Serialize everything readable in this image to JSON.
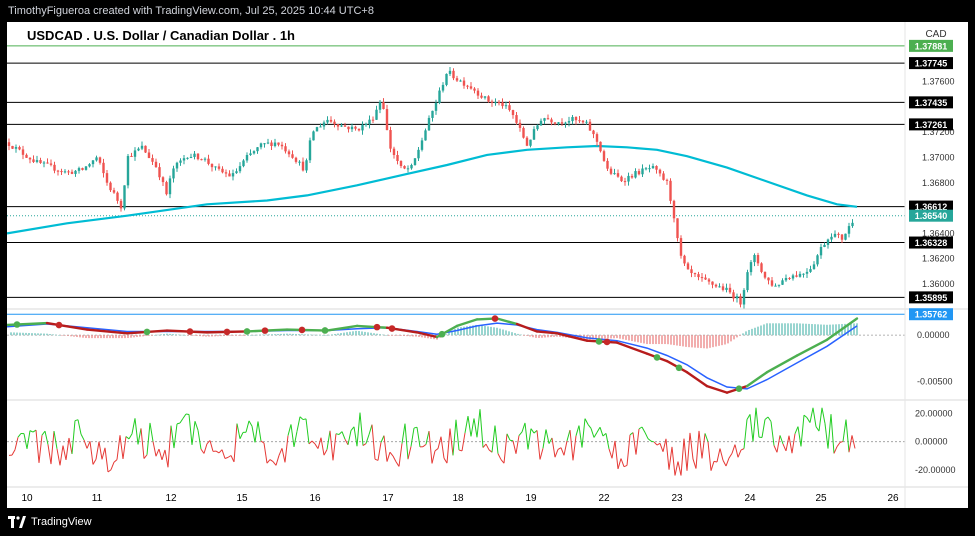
{
  "watermark": "TimothyFigueroa created with TradingView.com, Jul 25, 2025 10:44 UTC+8",
  "brand": "TradingView",
  "currency": "CAD",
  "chart_data": [
    {
      "type": "candlestick",
      "title": "USDCAD . U.S. Dollar / Canadian Dollar . 1h",
      "x_ticks": [
        "10",
        "11",
        "12",
        "15",
        "16",
        "17",
        "18",
        "19",
        "22",
        "23",
        "24",
        "25",
        "26"
      ],
      "y_ticks": [
        "1.37600",
        "1.37200",
        "1.37000",
        "1.36800",
        "1.36400",
        "1.36200",
        "1.36000"
      ],
      "ylim": [
        1.3574,
        1.3788
      ],
      "horizontal_levels": [
        1.37745,
        1.37435,
        1.37261,
        1.36612,
        1.36328,
        1.35895
      ],
      "price_labels": [
        {
          "text": "1.37881",
          "value": 1.37881,
          "color": "#4caf50",
          "line": true
        },
        {
          "text": "1.37745",
          "value": 1.37745,
          "color": "#000000",
          "line": false
        },
        {
          "text": "1.37435",
          "value": 1.37435,
          "color": "#000000",
          "line": false
        },
        {
          "text": "1.37261",
          "value": 1.37261,
          "color": "#000000",
          "line": false
        },
        {
          "text": "1.36612",
          "value": 1.36612,
          "color": "#000000",
          "line": false
        },
        {
          "text": "1.36540",
          "value": 1.3654,
          "color": "#26a69a",
          "line": true
        },
        {
          "text": "1.36328",
          "value": 1.36328,
          "color": "#000000",
          "line": false
        },
        {
          "text": "1.35895",
          "value": 1.35895,
          "color": "#000000",
          "line": false
        },
        {
          "text": "1.35762",
          "value": 1.35762,
          "color": "#2196f3",
          "line": true
        }
      ],
      "price_path": [
        [
          0,
          1.3712
        ],
        [
          18,
          1.3702
        ],
        [
          30,
          1.3696
        ],
        [
          45,
          1.3692
        ],
        [
          60,
          1.3688
        ],
        [
          75,
          1.369
        ],
        [
          90,
          1.37
        ],
        [
          100,
          1.368
        ],
        [
          110,
          1.3667
        ],
        [
          115,
          1.366
        ],
        [
          120,
          1.37
        ],
        [
          135,
          1.3708
        ],
        [
          150,
          1.3692
        ],
        [
          160,
          1.367
        ],
        [
          165,
          1.369
        ],
        [
          180,
          1.3702
        ],
        [
          195,
          1.37
        ],
        [
          210,
          1.369
        ],
        [
          225,
          1.3685
        ],
        [
          240,
          1.37
        ],
        [
          255,
          1.371
        ],
        [
          270,
          1.3712
        ],
        [
          285,
          1.3702
        ],
        [
          298,
          1.369
        ],
        [
          305,
          1.372
        ],
        [
          320,
          1.373
        ],
        [
          335,
          1.3725
        ],
        [
          350,
          1.3722
        ],
        [
          365,
          1.373
        ],
        [
          375,
          1.3748
        ],
        [
          382,
          1.371
        ],
        [
          395,
          1.369
        ],
        [
          405,
          1.3692
        ],
        [
          420,
          1.3725
        ],
        [
          432,
          1.375
        ],
        [
          440,
          1.3768
        ],
        [
          450,
          1.3762
        ],
        [
          465,
          1.3755
        ],
        [
          480,
          1.3745
        ],
        [
          495,
          1.3742
        ],
        [
          505,
          1.3735
        ],
        [
          520,
          1.371
        ],
        [
          535,
          1.3732
        ],
        [
          550,
          1.3728
        ],
        [
          565,
          1.373
        ],
        [
          580,
          1.3726
        ],
        [
          592,
          1.371
        ],
        [
          600,
          1.369
        ],
        [
          615,
          1.3682
        ],
        [
          630,
          1.3688
        ],
        [
          645,
          1.3692
        ],
        [
          660,
          1.368
        ],
        [
          668,
          1.365
        ],
        [
          672,
          1.3625
        ],
        [
          680,
          1.361
        ],
        [
          692,
          1.3604
        ],
        [
          705,
          1.36
        ],
        [
          718,
          1.3596
        ],
        [
          728,
          1.359
        ],
        [
          734,
          1.3585
        ],
        [
          740,
          1.361
        ],
        [
          748,
          1.3622
        ],
        [
          758,
          1.3605
        ],
        [
          768,
          1.3598
        ],
        [
          780,
          1.3606
        ],
        [
          795,
          1.3608
        ],
        [
          805,
          1.3614
        ],
        [
          815,
          1.363
        ],
        [
          825,
          1.364
        ],
        [
          835,
          1.3636
        ],
        [
          842,
          1.3645
        ],
        [
          848,
          1.3654
        ]
      ],
      "moving_average": [
        [
          0,
          1.364
        ],
        [
          60,
          1.3648
        ],
        [
          120,
          1.3654
        ],
        [
          200,
          1.3663
        ],
        [
          260,
          1.3666
        ],
        [
          300,
          1.367
        ],
        [
          350,
          1.3678
        ],
        [
          400,
          1.3687
        ],
        [
          440,
          1.3694
        ],
        [
          480,
          1.3702
        ],
        [
          520,
          1.3706
        ],
        [
          560,
          1.3708
        ],
        [
          590,
          1.3709
        ],
        [
          620,
          1.3708
        ],
        [
          650,
          1.3706
        ],
        [
          680,
          1.3701
        ],
        [
          720,
          1.3692
        ],
        [
          760,
          1.3681
        ],
        [
          800,
          1.367
        ],
        [
          830,
          1.3663
        ],
        [
          850,
          1.3661
        ]
      ]
    },
    {
      "type": "line",
      "ylim": [
        -0.007,
        0.0025
      ],
      "y_ticks": [
        "0.00000",
        "-0.00500"
      ],
      "zero_line": 0,
      "macd": [
        [
          0,
          0.0011
        ],
        [
          40,
          0.0013
        ],
        [
          80,
          0.0006
        ],
        [
          120,
          0.0002
        ],
        [
          160,
          0.0005
        ],
        [
          200,
          0.0003
        ],
        [
          240,
          0.0004
        ],
        [
          280,
          0.0006
        ],
        [
          320,
          0.0005
        ],
        [
          350,
          0.001
        ],
        [
          380,
          0.0008
        ],
        [
          410,
          0.0003
        ],
        [
          430,
          -0.0002
        ],
        [
          450,
          0.001
        ],
        [
          470,
          0.0017
        ],
        [
          490,
          0.0018
        ],
        [
          510,
          0.0012
        ],
        [
          530,
          0.0004
        ],
        [
          550,
          0.0002
        ],
        [
          580,
          -0.0006
        ],
        [
          610,
          -0.0008
        ],
        [
          640,
          -0.002
        ],
        [
          660,
          -0.0028
        ],
        [
          680,
          -0.004
        ],
        [
          700,
          -0.0055
        ],
        [
          720,
          -0.0062
        ],
        [
          740,
          -0.0055
        ],
        [
          760,
          -0.004
        ],
        [
          790,
          -0.0022
        ],
        [
          820,
          -0.0005
        ],
        [
          850,
          0.0018
        ]
      ],
      "signal": [
        [
          0,
          0.0009
        ],
        [
          40,
          0.0012
        ],
        [
          80,
          0.0008
        ],
        [
          120,
          0.0004
        ],
        [
          160,
          0.0004
        ],
        [
          200,
          0.0004
        ],
        [
          240,
          0.0004
        ],
        [
          280,
          0.0005
        ],
        [
          320,
          0.0005
        ],
        [
          350,
          0.0007
        ],
        [
          380,
          0.0008
        ],
        [
          410,
          0.0004
        ],
        [
          430,
          0.0001
        ],
        [
          450,
          0.0005
        ],
        [
          470,
          0.001
        ],
        [
          490,
          0.0013
        ],
        [
          510,
          0.0011
        ],
        [
          530,
          0.0006
        ],
        [
          550,
          0.0003
        ],
        [
          580,
          -0.0003
        ],
        [
          610,
          -0.0006
        ],
        [
          640,
          -0.0014
        ],
        [
          660,
          -0.0022
        ],
        [
          680,
          -0.0032
        ],
        [
          700,
          -0.0046
        ],
        [
          720,
          -0.0056
        ],
        [
          740,
          -0.0058
        ],
        [
          760,
          -0.0048
        ],
        [
          790,
          -0.003
        ],
        [
          820,
          -0.0012
        ],
        [
          850,
          0.001
        ]
      ],
      "cross_markers": [
        {
          "x": 10,
          "color": "#4caf50"
        },
        {
          "x": 52,
          "color": "#c62828"
        },
        {
          "x": 140,
          "color": "#4caf50"
        },
        {
          "x": 183,
          "color": "#c62828"
        },
        {
          "x": 220,
          "color": "#c62828"
        },
        {
          "x": 240,
          "color": "#4caf50"
        },
        {
          "x": 258,
          "color": "#c62828"
        },
        {
          "x": 295,
          "color": "#c62828"
        },
        {
          "x": 318,
          "color": "#4caf50"
        },
        {
          "x": 370,
          "color": "#c62828"
        },
        {
          "x": 385,
          "color": "#c62828"
        },
        {
          "x": 435,
          "color": "#4caf50"
        },
        {
          "x": 488,
          "color": "#c62828"
        },
        {
          "x": 592,
          "color": "#4caf50"
        },
        {
          "x": 600,
          "color": "#c62828"
        },
        {
          "x": 650,
          "color": "#4caf50"
        },
        {
          "x": 672,
          "color": "#4caf50"
        },
        {
          "x": 732,
          "color": "#4caf50"
        }
      ]
    },
    {
      "type": "line",
      "ylim": [
        -30,
        26
      ],
      "y_ticks": [
        "20.00000",
        "0.00000",
        "-20.00000"
      ],
      "zero_line": 0,
      "oscillator_seed": 7
    }
  ]
}
